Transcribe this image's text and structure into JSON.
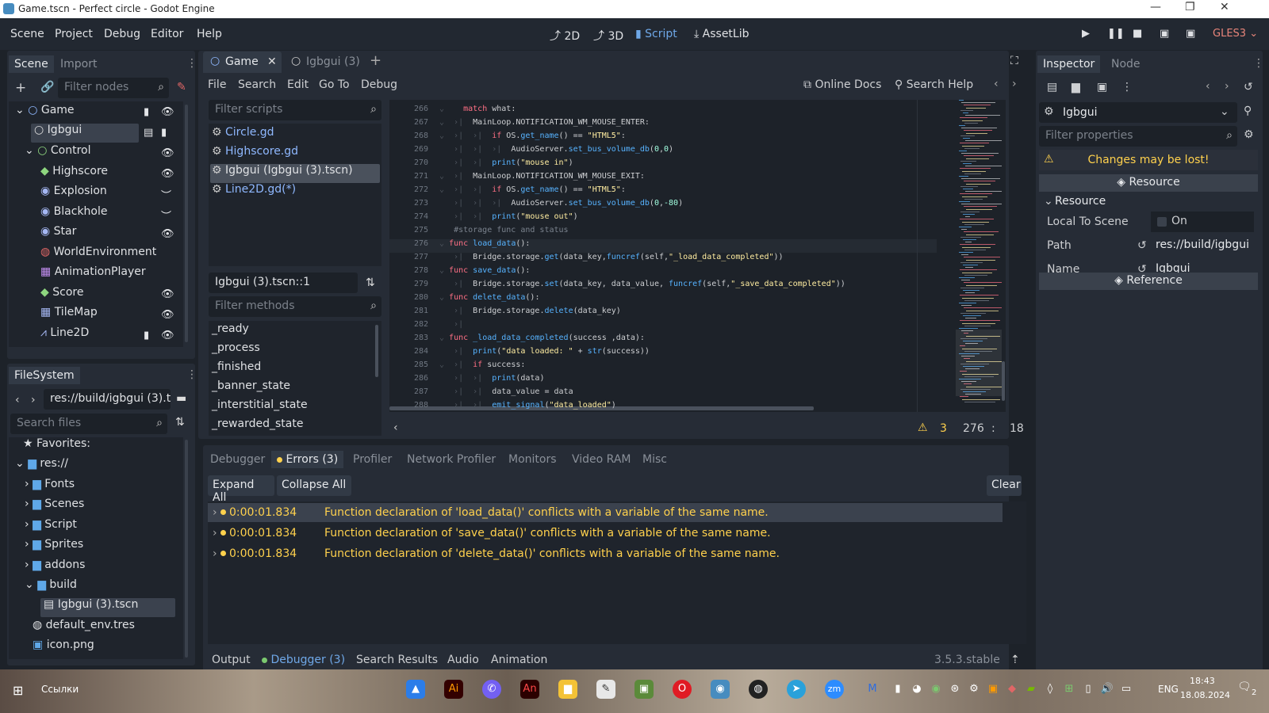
{
  "window": {
    "title": "Game.tscn - Perfect circle - Godot Engine"
  },
  "menu": [
    "Scene",
    "Project",
    "Debug",
    "Editor",
    "Help"
  ],
  "workspaces": [
    "2D",
    "3D",
    "Script",
    "AssetLib"
  ],
  "renderer": "GLES3",
  "scene_dock": {
    "tabs": [
      "Scene",
      "Import"
    ],
    "filter_placeholder": "Filter nodes",
    "nodes": [
      "Game",
      "Igbgui",
      "Control",
      "Highscore",
      "Explosion",
      "Blackhole",
      "Star",
      "WorldEnvironment",
      "AnimationPlayer",
      "Score",
      "TileMap",
      "Line2D"
    ]
  },
  "filesystem": {
    "tab": "FileSystem",
    "path": "res://build/igbgui (3).t",
    "search_placeholder": "Search files",
    "items": [
      "Favorites:",
      "res://",
      "Fonts",
      "Scenes",
      "Script",
      "Sprites",
      "addons",
      "build",
      "Igbgui (3).tscn",
      "default_env.tres",
      "icon.png"
    ]
  },
  "editor_tabs": [
    "Game",
    "Igbgui (3)"
  ],
  "script_menu": [
    "File",
    "Search",
    "Edit",
    "Go To",
    "Debug"
  ],
  "online_docs": "Online Docs",
  "search_help": "Search Help",
  "scripts": {
    "filter_placeholder": "Filter scripts",
    "list": [
      "Circle.gd",
      "Highscore.gd",
      "Igbgui (Igbgui (3).tscn)",
      "Line2D.gd(*)"
    ],
    "current": "Igbgui (3).tscn::1",
    "methods_placeholder": "Filter methods",
    "methods": [
      "_ready",
      "_process",
      "_finished",
      "_banner_state",
      "_interstitial_state",
      "_rewarded_state"
    ]
  },
  "code": {
    "lines": [
      "266",
      "267",
      "268",
      "269",
      "270",
      "271",
      "272",
      "273",
      "274",
      "275",
      "276",
      "277",
      "278",
      "279",
      "280",
      "281",
      "282",
      "283",
      "284",
      "285",
      "286",
      "287",
      "288"
    ]
  },
  "status": {
    "warnings": "3",
    "line": "276",
    "sep": ":",
    "col": "18"
  },
  "bottom": {
    "tabs": [
      "Debugger",
      "Errors (3)",
      "Profiler",
      "Network Profiler",
      "Monitors",
      "Video RAM",
      "Misc"
    ],
    "expand": "Expand All",
    "collapse": "Collapse All",
    "clear": "Clear",
    "errors": [
      {
        "time": "0:00:01.834",
        "msg": "Function declaration of 'load_data()' conflicts with a variable of the same name."
      },
      {
        "time": "0:00:01.834",
        "msg": "Function declaration of 'save_data()' conflicts with a variable of the same name."
      },
      {
        "time": "0:00:01.834",
        "msg": "Function declaration of 'delete_data()' conflicts with a variable of the same name."
      }
    ]
  },
  "output_bar": [
    "Output",
    "Debugger (3)",
    "Search Results",
    "Audio",
    "Animation"
  ],
  "version": "3.5.3.stable",
  "inspector": {
    "tabs": [
      "Inspector",
      "Node"
    ],
    "object": "Igbgui",
    "filter_placeholder": "Filter properties",
    "warning": "Changes may be lost!",
    "resource_header": "Resource",
    "resource_section": "Resource",
    "props": [
      {
        "label": "Local To Scene",
        "value": "On"
      },
      {
        "label": "Path",
        "value": "res://build/igbgui"
      },
      {
        "label": "Name",
        "value": "Igbgui"
      }
    ],
    "reference": "Reference"
  },
  "taskbar": {
    "links": "Ссылки",
    "lang": "ENG",
    "time": "18:43",
    "date": "18.08.2024",
    "notif": "2"
  }
}
